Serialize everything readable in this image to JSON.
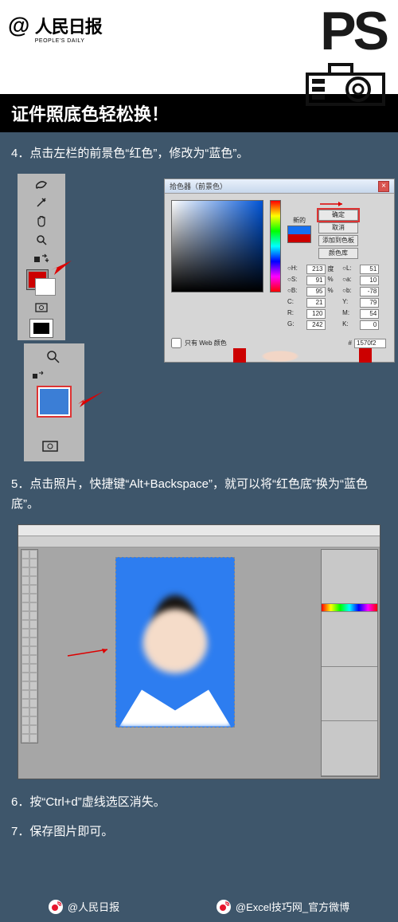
{
  "brand": {
    "at": "@",
    "cn": "人民日报",
    "en": "PEOPLE'S DAILY"
  },
  "ps_logo": "PS",
  "title": "证件照底色轻松换！",
  "steps": {
    "s4": "4．点击左栏的前景色“红色”，修改为“蓝色”。",
    "s5": "5．点击照片，快捷键“Alt+Backspace”，就可以将“红色底”换为“蓝色底”。",
    "s6": "6．按“Ctrl+d”虚线选区消失。",
    "s7": "7．保存图片即可。"
  },
  "picker": {
    "title": "拾色器（前景色）",
    "new_label": "新的",
    "btn_ok": "确定",
    "btn_cancel": "取消",
    "btn_add": "添加到色板",
    "btn_lib": "颜色库",
    "web_only": "只有 Web 颜色",
    "hex_label": "#",
    "hex_value": "1570f2",
    "fields": {
      "H": "213",
      "Hdeg": "度",
      "L": "51",
      "S": "91",
      "Spct": "%",
      "a": "10",
      "B": "95",
      "Bpct": "%",
      "b": "-78",
      "C": "21",
      "Y": "79",
      "R": "120",
      "M": "54",
      "G": "242",
      "K": "0"
    }
  },
  "footer": {
    "a": "@人民日报",
    "b": "@Excel技巧网_官方微博"
  }
}
